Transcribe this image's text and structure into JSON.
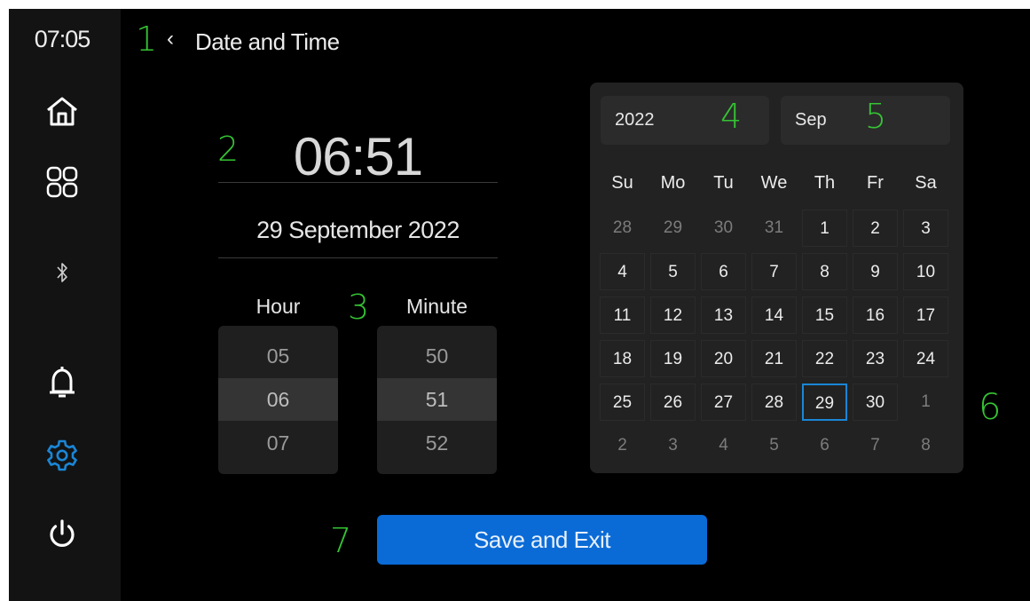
{
  "status": {
    "time": "07:05"
  },
  "nav": {
    "items": [
      {
        "icon": "home-icon"
      },
      {
        "icon": "apps-grid-icon"
      },
      {
        "icon": "bluetooth-icon"
      },
      {
        "icon": "bell-icon"
      },
      {
        "icon": "gear-icon",
        "active": true
      },
      {
        "icon": "power-icon"
      }
    ]
  },
  "header": {
    "back": "‹",
    "title": "Date and Time"
  },
  "clock": {
    "time": "06:51",
    "date": "29 September 2022"
  },
  "pickers": {
    "hour": {
      "label": "Hour",
      "values": [
        "05",
        "06",
        "07"
      ],
      "selected": "06"
    },
    "minute": {
      "label": "Minute",
      "values": [
        "50",
        "51",
        "52"
      ],
      "selected": "51"
    }
  },
  "calendar": {
    "year": "2022",
    "month": "Sep",
    "weekdays": [
      "Su",
      "Mo",
      "Tu",
      "We",
      "Th",
      "Fr",
      "Sa"
    ],
    "weeks": [
      [
        "28",
        "29",
        "30",
        "31",
        "1",
        "2",
        "3"
      ],
      [
        "4",
        "5",
        "6",
        "7",
        "8",
        "9",
        "10"
      ],
      [
        "11",
        "12",
        "13",
        "14",
        "15",
        "16",
        "17"
      ],
      [
        "18",
        "19",
        "20",
        "21",
        "22",
        "23",
        "24"
      ],
      [
        "25",
        "26",
        "27",
        "28",
        "29",
        "30",
        "1"
      ],
      [
        "2",
        "3",
        "4",
        "5",
        "6",
        "7",
        "8"
      ]
    ],
    "selected_day": "29"
  },
  "save_button": "Save and Exit",
  "annotations": [
    "1",
    "2",
    "3",
    "4",
    "5",
    "6",
    "7"
  ],
  "colors": {
    "accent": "#0a6bd6",
    "annotation": "#35c434",
    "selected_outline": "#1a86d6",
    "active_icon": "#1a86d6"
  }
}
